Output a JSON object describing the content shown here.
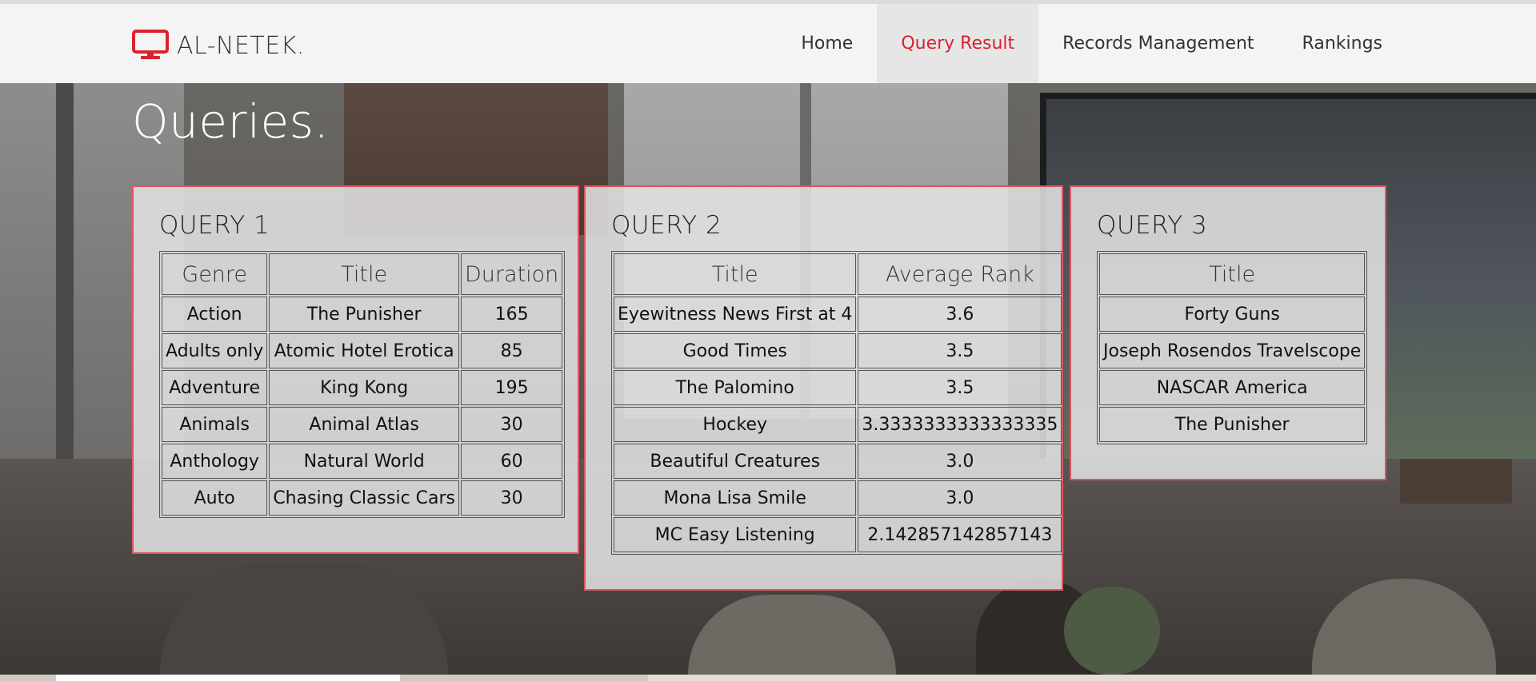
{
  "brand": {
    "name": "AL-NETEK.",
    "icon": "monitor-icon",
    "accent_color": "#d9232e"
  },
  "nav": {
    "items": [
      {
        "label": "Home"
      },
      {
        "label": "Query Result",
        "active": true
      },
      {
        "label": "Records Management"
      },
      {
        "label": "Rankings"
      }
    ]
  },
  "page": {
    "title": "Queries."
  },
  "queries": [
    {
      "title": "QUERY 1",
      "columns": [
        "Genre",
        "Title",
        "Duration"
      ],
      "rows": [
        [
          "Action",
          "The Punisher",
          "165"
        ],
        [
          "Adults only",
          "Atomic Hotel Erotica",
          "85"
        ],
        [
          "Adventure",
          "King Kong",
          "195"
        ],
        [
          "Animals",
          "Animal Atlas",
          "30"
        ],
        [
          "Anthology",
          "Natural World",
          "60"
        ],
        [
          "Auto",
          "Chasing Classic Cars",
          "30"
        ]
      ]
    },
    {
      "title": "QUERY 2",
      "columns": [
        "Title",
        "Average Rank"
      ],
      "rows": [
        [
          "Eyewitness News First at 4",
          "3.6"
        ],
        [
          "Good Times",
          "3.5"
        ],
        [
          "The Palomino",
          "3.5"
        ],
        [
          "Hockey",
          "3.3333333333333335"
        ],
        [
          "Beautiful Creatures",
          "3.0"
        ],
        [
          "Mona Lisa Smile",
          "3.0"
        ],
        [
          "MC Easy Listening",
          "2.142857142857143"
        ]
      ]
    },
    {
      "title": "QUERY 3",
      "columns": [
        "Title"
      ],
      "rows": [
        [
          "Forty Guns"
        ],
        [
          "Joseph Rosendos Travelscope"
        ],
        [
          "NASCAR America"
        ],
        [
          "The Punisher"
        ]
      ]
    }
  ]
}
